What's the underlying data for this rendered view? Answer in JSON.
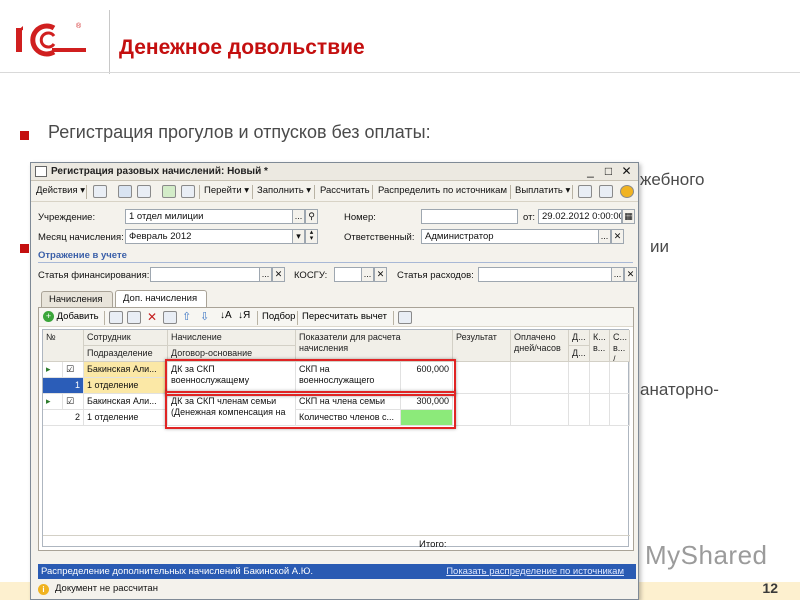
{
  "slide": {
    "title": "Денежное довольствие",
    "logo_text": "1С",
    "bullets": [
      {
        "text": "Регистрация прогулов и отпусков без оплаты:"
      }
    ],
    "peek_texts": [
      "жебного",
      "ии",
      "анаторно-"
    ],
    "page_number": "12",
    "watermark": "MyShared"
  },
  "window": {
    "title": "Регистрация разовых начислений: Новый *",
    "toolbar": {
      "actions": "Действия",
      "goto": "Перейти",
      "fill": "Заполнить",
      "calculate": "Рассчитать",
      "distribute": "Распределить по источникам",
      "pay": "Выплатить"
    },
    "header": {
      "institution_label": "Учреждение:",
      "institution_value": "1 отдел милиции",
      "number_label": "Номер:",
      "number_value": "",
      "date_label": "от:",
      "date_value": "29.02.2012  0:00:00",
      "month_label": "Месяц начисления:",
      "month_value": "Февраль 2012",
      "responsible_label": "Ответственный:",
      "responsible_value": "Администратор"
    },
    "accounting": {
      "section_title": "Отражение в учете",
      "funding_label": "Статья финансирования:",
      "funding_value": "",
      "kosgu_label": "КОСГУ:",
      "kosgu_value": "",
      "expense_label": "Статья расходов:",
      "expense_value": ""
    },
    "tabs": [
      {
        "label": "Начисления",
        "active": false
      },
      {
        "label": "Доп. начисления",
        "active": true
      }
    ],
    "grid_toolbar": {
      "add": "Добавить",
      "pick": "Подбор",
      "recalc": "Пересчитать вычет"
    },
    "columns": {
      "num": "№",
      "employee": "Сотрудник",
      "department": "Подразделение",
      "accrual": "Начисление",
      "contract": "Договор-основание",
      "indicators": "Показатели для расчета начисления",
      "result": "Результат",
      "paid_days": "Оплачено дней/часов",
      "c_d1": "Д...",
      "c_d2": "Д...",
      "c_k": "К... в...",
      "c_s": "С... в... /"
    },
    "rows": [
      {
        "num": "1",
        "employee": "Бакинская Али...",
        "department": "1 отделение",
        "accrual": "ДК за СКП военнослужащему",
        "indicator_name": "СКП на военнослужащего",
        "indicator_value": "600,000"
      },
      {
        "num": "2",
        "employee": "Бакинская Али...",
        "department": "1 отделение",
        "accrual": "ДК за СКП членам семьи (Денежная компенсация на",
        "indicator_name": "СКП на члена семьи",
        "indicator_value": "300,000",
        "indicator2_name": "Количество членов с...",
        "indicator2_value": ""
      }
    ],
    "total_label": "Итого:",
    "status_bar": {
      "left": "Распределение дополнительных начислений Бакинской А.Ю.",
      "right": "Показать распределение по источникам"
    },
    "info_message": "Документ не рассчитан"
  },
  "colors": {
    "title_red": "#c40f0f",
    "status_blue": "#2a5bb3",
    "highlight_red": "#e02424",
    "green_cell": "#8cea7a"
  }
}
